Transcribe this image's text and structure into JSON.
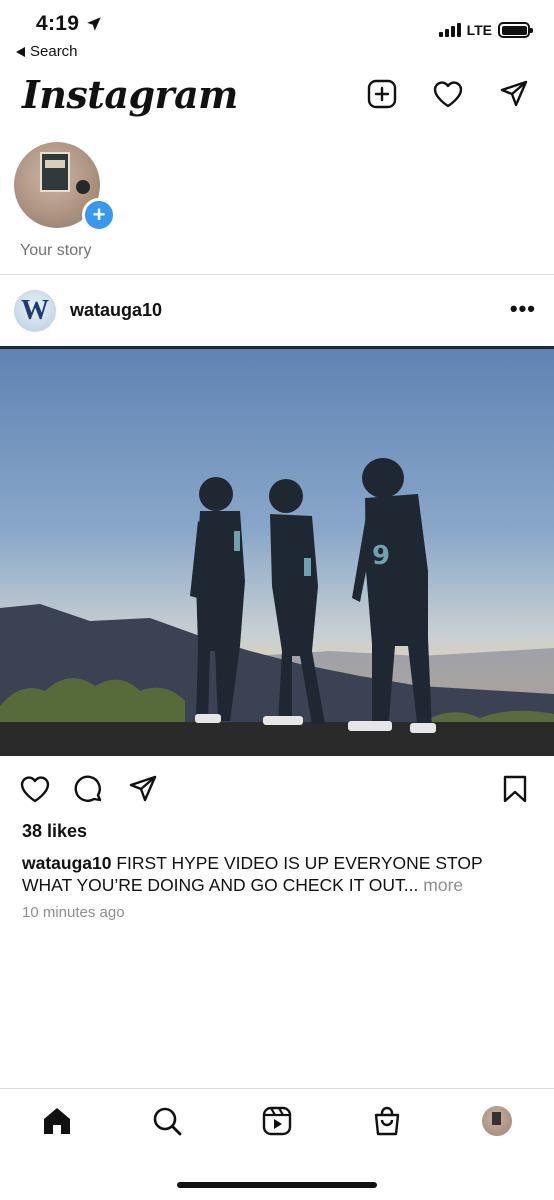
{
  "status_bar": {
    "time": "4:19",
    "back_label": "Search",
    "network": "LTE",
    "icons": [
      "location-arrow-icon",
      "signal-icon",
      "battery-icon"
    ]
  },
  "header": {
    "logo": "Instagram",
    "icons": [
      "new-post-icon",
      "heart-icon",
      "direct-message-icon"
    ]
  },
  "stories": {
    "items": [
      {
        "label": "Your story",
        "badge": "+"
      }
    ]
  },
  "post": {
    "username": "watauga10",
    "avatar_letter": "W",
    "more_label": "•••",
    "likes": "38 likes",
    "caption_user": "watauga10",
    "caption_text": " FIRST HYPE VIDEO IS UP EVERYONE STOP WHAT YOU’RE DOING AND GO CHECK IT OUT...",
    "caption_more": " more",
    "time_ago": "10 minutes ago",
    "action_icons": [
      "like-heart-icon",
      "comment-icon",
      "share-icon",
      "bookmark-icon"
    ]
  },
  "bottom_nav": {
    "items": [
      "home-icon",
      "search-icon",
      "reels-icon",
      "shop-icon",
      "profile-icon"
    ]
  },
  "colors": {
    "accent_blue": "#3897f0",
    "divider": "#dbdbdb",
    "secondary_text": "#737373"
  }
}
